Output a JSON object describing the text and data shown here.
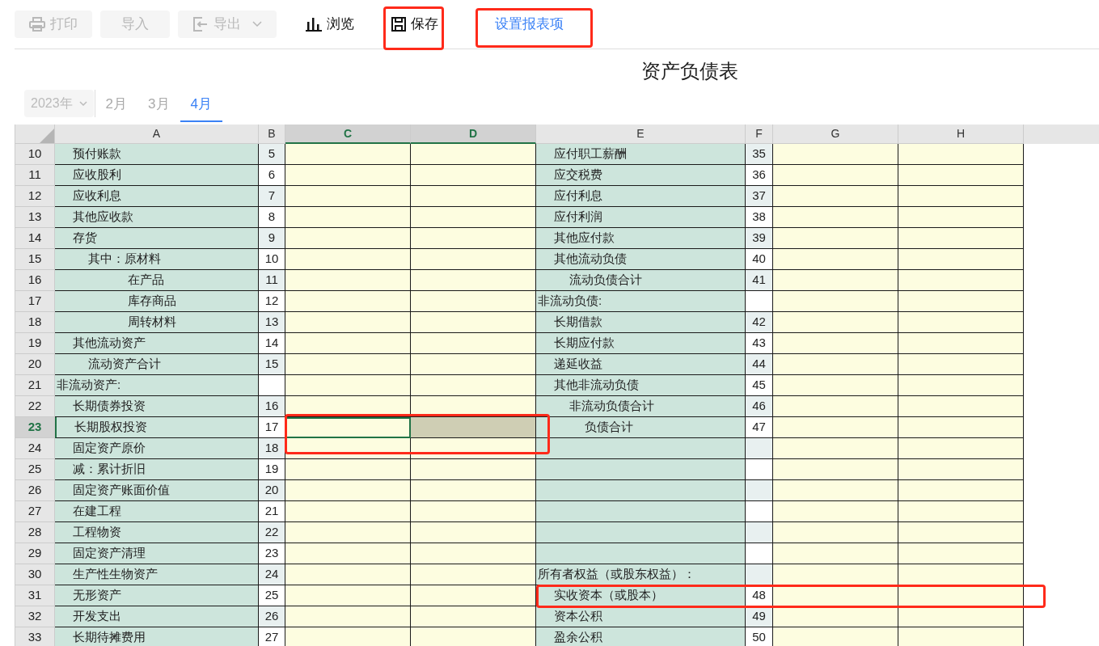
{
  "toolbar": [
    {
      "label": "打印",
      "disabled": true,
      "dropdown": false
    },
    {
      "label": "导入",
      "disabled": true,
      "dropdown": false
    },
    {
      "label": "导出",
      "disabled": true,
      "dropdown": true
    },
    {
      "label": "浏览",
      "disabled": false,
      "dropdown": false
    },
    {
      "label": "保存",
      "disabled": false,
      "dropdown": false
    }
  ],
  "link": "设置报表项",
  "title": "资产负债表",
  "year": "2023年",
  "months": [
    {
      "label": "2月",
      "selected": false
    },
    {
      "label": "3月",
      "selected": false
    },
    {
      "label": "4月",
      "selected": true
    }
  ],
  "columns": [
    "A",
    "B",
    "C",
    "D",
    "E",
    "F",
    "G",
    "H"
  ],
  "rows": [
    {
      "num": "10",
      "selected": false,
      "a": {
        "text": "预付账款",
        "kind": "item"
      },
      "b": "5",
      "e": {
        "text": "应付职工薪酬",
        "kind": "item"
      },
      "f": "35"
    },
    {
      "num": "11",
      "selected": false,
      "a": {
        "text": "应收股利",
        "kind": "item"
      },
      "b": "6",
      "e": {
        "text": "应交税费",
        "kind": "item"
      },
      "f": "36"
    },
    {
      "num": "12",
      "selected": false,
      "a": {
        "text": "应收利息",
        "kind": "item"
      },
      "b": "7",
      "e": {
        "text": "应付利息",
        "kind": "item"
      },
      "f": "37"
    },
    {
      "num": "13",
      "selected": false,
      "a": {
        "text": "其他应收款",
        "kind": "item"
      },
      "b": "8",
      "e": {
        "text": "应付利润",
        "kind": "item"
      },
      "f": "38"
    },
    {
      "num": "14",
      "selected": false,
      "a": {
        "text": "存货",
        "kind": "item"
      },
      "b": "9",
      "e": {
        "text": "其他应付款",
        "kind": "item"
      },
      "f": "39"
    },
    {
      "num": "15",
      "selected": false,
      "a": {
        "text": "其中：原材料",
        "kind": "subtotal"
      },
      "b": "10",
      "e": {
        "text": "其他流动负债",
        "kind": "item"
      },
      "f": "40"
    },
    {
      "num": "16",
      "selected": false,
      "a": {
        "text": "在产品",
        "kind": "detail"
      },
      "b": "11",
      "e": {
        "text": "流动负债合计",
        "kind": "subtotal"
      },
      "f": "41"
    },
    {
      "num": "17",
      "selected": false,
      "a": {
        "text": "库存商品",
        "kind": "detail"
      },
      "b": "12",
      "e": {
        "text": "非流动负债:",
        "kind": "section"
      }
    },
    {
      "num": "18",
      "selected": false,
      "a": {
        "text": "周转材料",
        "kind": "detail"
      },
      "b": "13",
      "e": {
        "text": "长期借款",
        "kind": "item"
      },
      "f": "42"
    },
    {
      "num": "19",
      "selected": false,
      "a": {
        "text": "其他流动资产",
        "kind": "item"
      },
      "b": "14",
      "e": {
        "text": "长期应付款",
        "kind": "item"
      },
      "f": "43"
    },
    {
      "num": "20",
      "selected": false,
      "a": {
        "text": "流动资产合计",
        "kind": "subtotal"
      },
      "b": "15",
      "e": {
        "text": "递延收益",
        "kind": "item"
      },
      "f": "44"
    },
    {
      "num": "21",
      "selected": false,
      "a": {
        "text": "非流动资产:",
        "kind": "section"
      },
      "e": {
        "text": "其他非流动负债",
        "kind": "item"
      },
      "f": "45"
    },
    {
      "num": "22",
      "selected": false,
      "a": {
        "text": "长期债券投资",
        "kind": "item"
      },
      "b": "16",
      "e": {
        "text": "非流动负债合计",
        "kind": "subtotal"
      },
      "f": "46"
    },
    {
      "num": "23",
      "selected": true,
      "a": {
        "text": "长期股权投资",
        "kind": "item"
      },
      "b": "17",
      "e": {
        "text": "负债合计",
        "kind": "total"
      },
      "f": "47"
    },
    {
      "num": "24",
      "selected": false,
      "a": {
        "text": "固定资产原价",
        "kind": "item"
      },
      "b": "18"
    },
    {
      "num": "25",
      "selected": false,
      "a": {
        "text": "减：累计折旧",
        "kind": "item"
      },
      "b": "19"
    },
    {
      "num": "26",
      "selected": false,
      "a": {
        "text": "固定资产账面价值",
        "kind": "item"
      },
      "b": "20"
    },
    {
      "num": "27",
      "selected": false,
      "a": {
        "text": "在建工程",
        "kind": "item"
      },
      "b": "21"
    },
    {
      "num": "28",
      "selected": false,
      "a": {
        "text": "工程物资",
        "kind": "item"
      },
      "b": "22"
    },
    {
      "num": "29",
      "selected": false,
      "a": {
        "text": "固定资产清理",
        "kind": "item"
      },
      "b": "23"
    },
    {
      "num": "30",
      "selected": false,
      "a": {
        "text": "生产性生物资产",
        "kind": "item"
      },
      "b": "24",
      "e": {
        "text": "所有者权益（或股东权益）：",
        "kind": "section"
      }
    },
    {
      "num": "31",
      "selected": false,
      "a": {
        "text": "无形资产",
        "kind": "item"
      },
      "b": "25",
      "e": {
        "text": "实收资本（或股本）",
        "kind": "item"
      },
      "f": "48"
    },
    {
      "num": "32",
      "selected": false,
      "a": {
        "text": "开发支出",
        "kind": "item"
      },
      "b": "26",
      "e": {
        "text": "资本公积",
        "kind": "item"
      },
      "f": "49"
    },
    {
      "num": "33",
      "selected": false,
      "a": {
        "text": "长期待摊费用",
        "kind": "item"
      },
      "b": "27",
      "e": {
        "text": "盈余公积",
        "kind": "item"
      },
      "f": "50"
    }
  ]
}
